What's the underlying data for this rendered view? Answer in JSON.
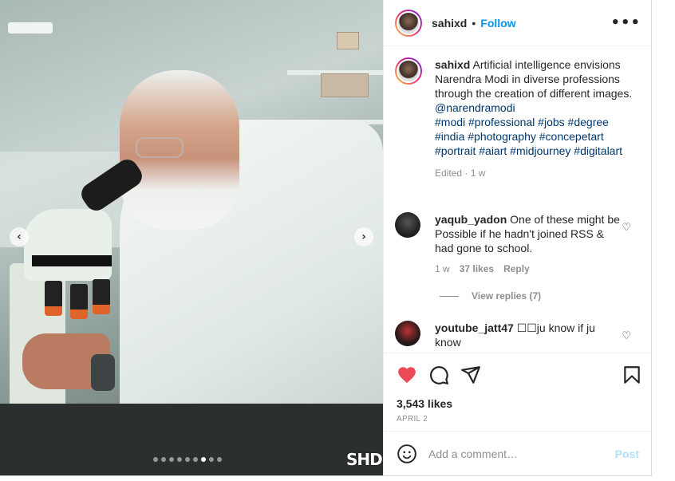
{
  "post": {
    "author": "sahixd",
    "separator": "•",
    "follow_label": "Follow",
    "more_label": "•••",
    "media": {
      "image_description": "AI generated scientist looking into microscope",
      "watermark": "SHD",
      "slide_count": 9,
      "active_slide": 7,
      "prev_label": "‹",
      "next_label": "›"
    }
  },
  "caption": {
    "author": "sahixd",
    "text": "Artificial intelligence envisions Narendra Modi in diverse professions through the creation of different images.",
    "mention": "@narendramodi",
    "tags": "#modi #professional #jobs #degree #india #photography #concepetart #portrait #aiart #midjourney #digitalart",
    "meta": "Edited · 1 w"
  },
  "comments": [
    {
      "author": "yaqub_yadon",
      "text": "One of these might be Possible if he hadn't joined RSS & had gone to school.",
      "time": "1 w",
      "likes": "37 likes",
      "reply_label": "Reply",
      "view_replies": "View replies (7)"
    },
    {
      "author": "youtube_jatt47",
      "text": "☐☐ju know if ju know"
    }
  ],
  "actions": {
    "like_icon": "heart-filled-icon",
    "comment_icon": "comment-icon",
    "share_icon": "paper-plane-icon",
    "save_icon": "bookmark-icon",
    "like_color": "#ed4956"
  },
  "stats": {
    "likes": "3,543 likes",
    "date": "APRIL 2"
  },
  "add_comment": {
    "placeholder": "Add a comment…",
    "post_label": "Post"
  },
  "colors": {
    "follow": "#0095f6",
    "hashtag": "#00376b",
    "muted": "#8e8e8e",
    "post_disabled": "#b2dffc"
  }
}
